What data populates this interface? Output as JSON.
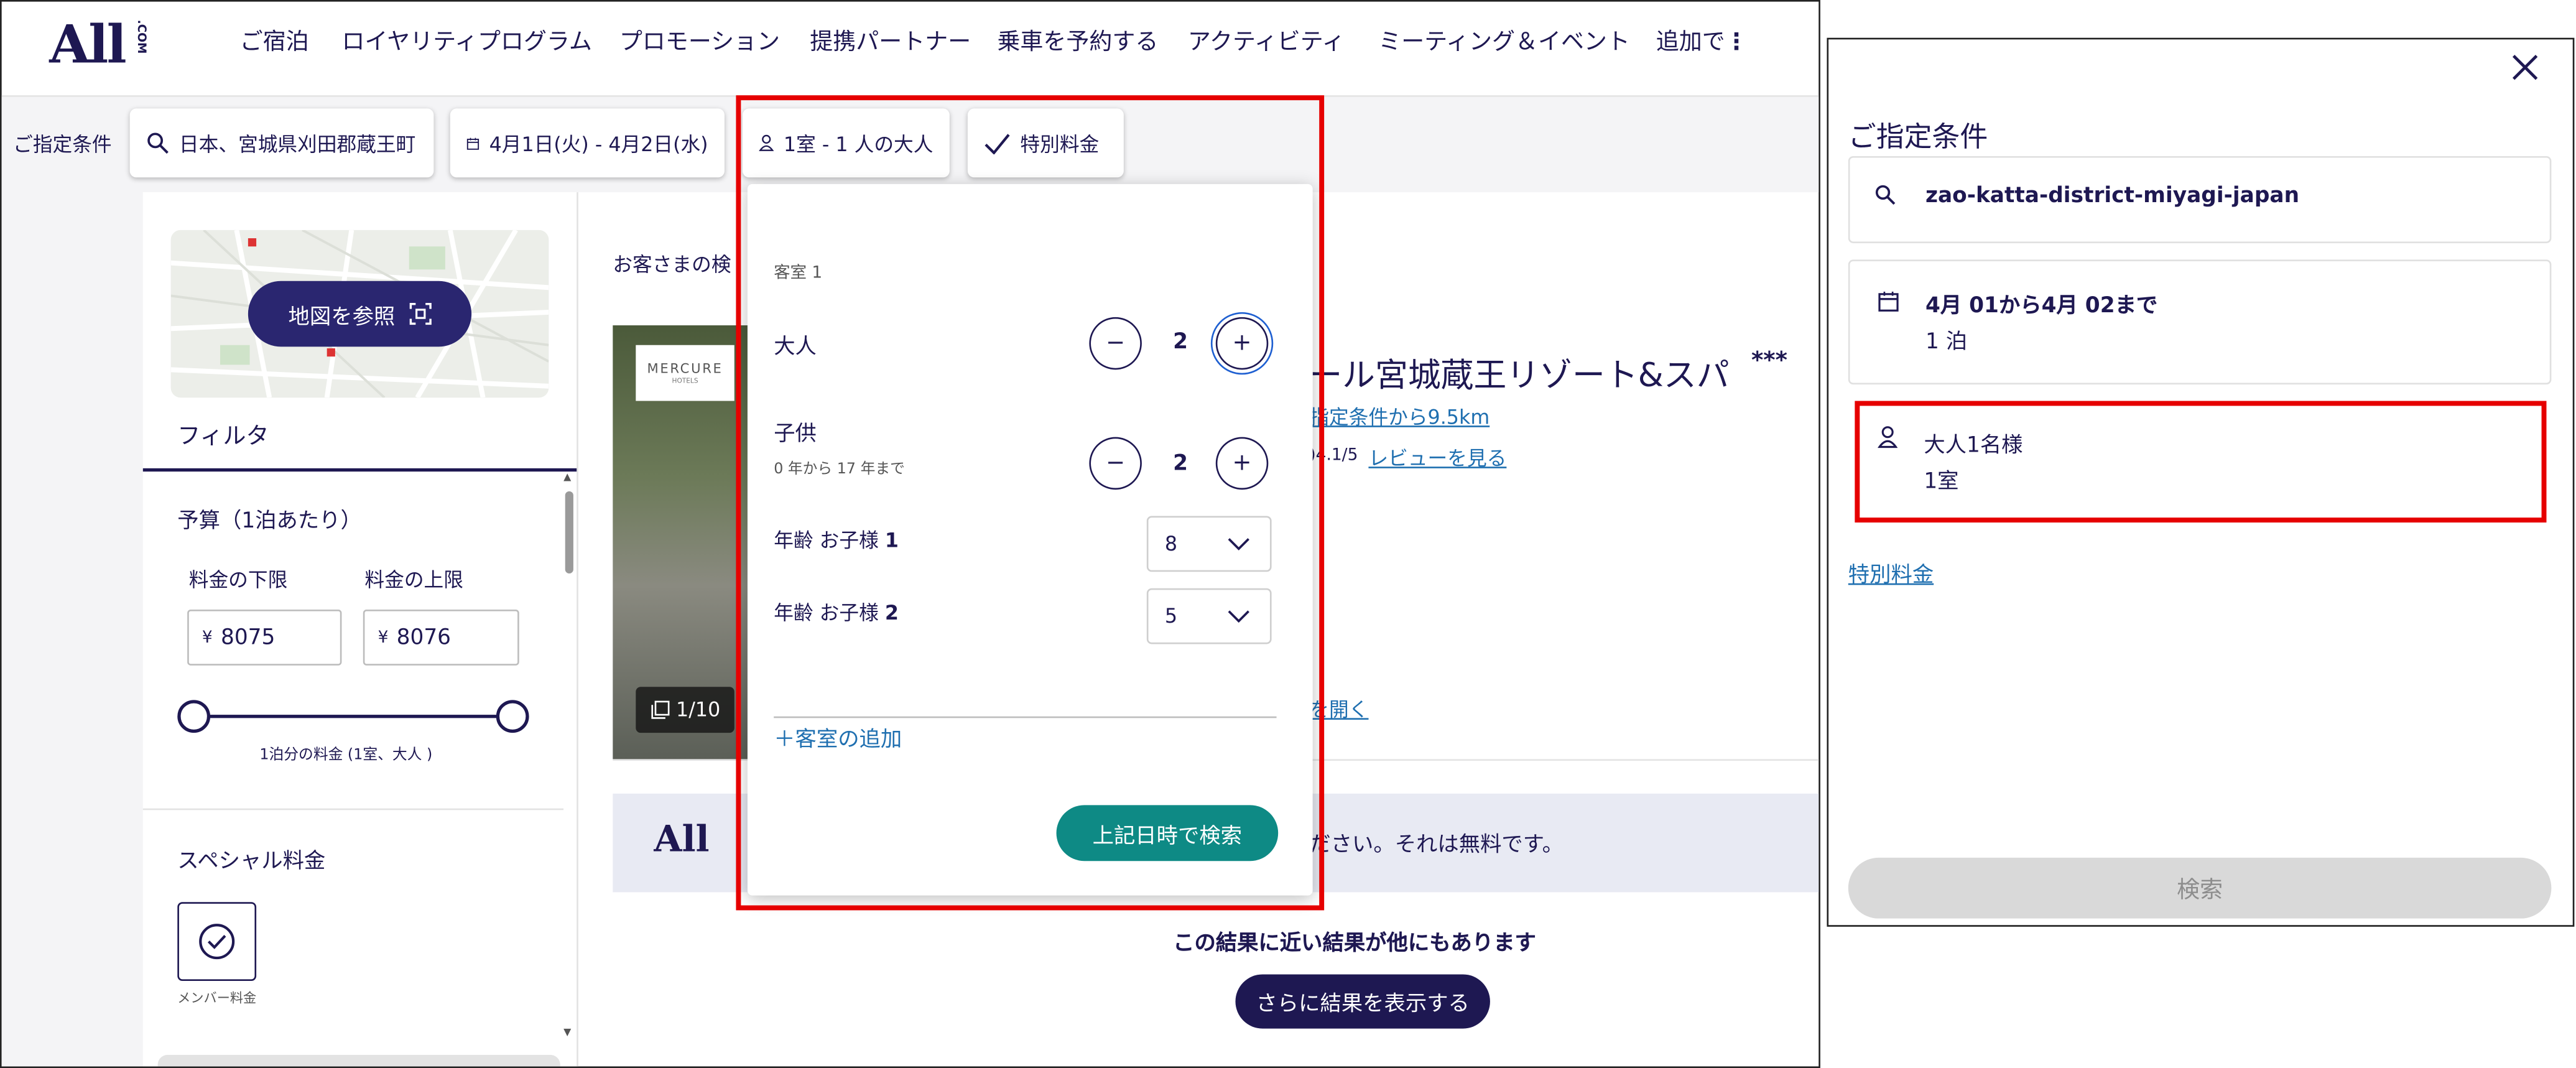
{
  "header": {
    "logo_main": "All",
    "logo_sub": ".COM",
    "nav": [
      "ご宿泊",
      "ロイヤリティプログラム",
      "プロモーション",
      "提携パートナー",
      "乗車を予約する",
      "アクティビティ",
      "ミーティング＆イベント",
      "追加で"
    ]
  },
  "search_bar": {
    "label": "ご指定条件",
    "destination": "日本、宮城県刈田郡蔵王町",
    "dates": "4月1日(火) - 4月2日(水)",
    "guests": "1室 - 1 人の大人",
    "special_rate": "特別料金"
  },
  "sidebar": {
    "map_button": "地図を参照",
    "filter_title": "フィルタ",
    "budget_title": "予算（1泊あたり）",
    "min_label": "料金の下限",
    "max_label": "料金の上限",
    "currency": "¥",
    "min_value": "8075",
    "max_value": "8076",
    "slider_caption": "1泊分の料金 (1室、大人 )",
    "special_title": "スペシャル料金",
    "member_label": "メンバー料金"
  },
  "results": {
    "intro_text": "お客さまの検",
    "hotel_brand": "MERCURE",
    "hotel_brand_sub": "HOTELS",
    "photo_count": "1/10",
    "hotel_name": "ール宮城蔵王リゾート&スパ",
    "stars": "***",
    "distance_link": "指定条件から9.5km",
    "rating": ")4.1/5",
    "review_link": "レビューを見る",
    "open_link": "を開く",
    "banner_logo": "All",
    "banner_text": "ださい。それは無料です。",
    "nearby_title": "この結果に近い結果が他にもあります",
    "more_button": "さらに結果を表示する"
  },
  "guest_popup": {
    "room_label": "客室 1",
    "adults_label": "大人",
    "adults_value": "2",
    "children_label": "子供",
    "children_hint": "0 年から 17 年まで",
    "children_value": "2",
    "child1_label_prefix": "年齢 お子様 ",
    "child1_num": "1",
    "child1_age": "8",
    "child2_label_prefix": "年齢 お子様 ",
    "child2_num": "2",
    "child2_age": "5",
    "add_room": "＋客室の追加",
    "search_button": "上記日時で検索",
    "minus": "−",
    "plus": "+"
  },
  "right_panel": {
    "title": "ご指定条件",
    "destination": "zao-katta-district-miyagi-japan",
    "dates_line1": "4月 01から4月 02まで",
    "nights": "1 泊",
    "guests_line1": "大人1名様",
    "rooms": "1室",
    "special_link": "特別料金",
    "search_button": "検索"
  },
  "colors": {
    "navy": "#1e1852",
    "teal": "#0e8a85",
    "highlight": "#e60000",
    "link": "#1f6fb0"
  }
}
